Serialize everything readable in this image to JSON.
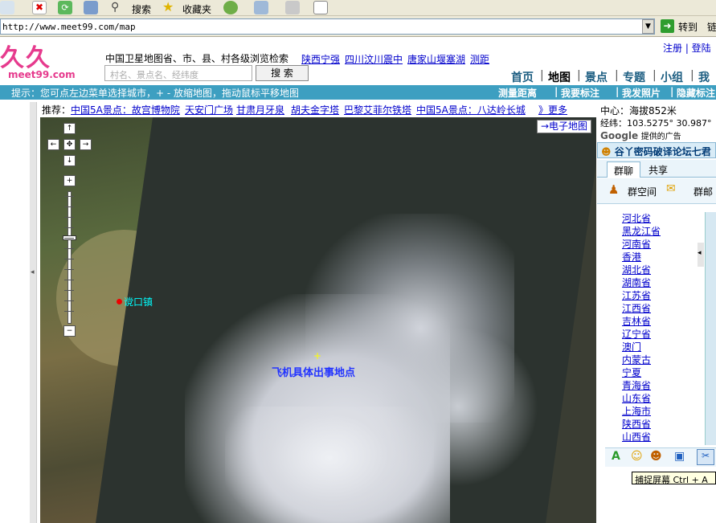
{
  "browser": {
    "toolbar": {
      "search_label": "搜索",
      "favorites_label": "收藏夹"
    },
    "address": {
      "url": "http://www.meet99.com/map",
      "go_label": "转到",
      "links_label": "链"
    }
  },
  "site": {
    "logo_text": "久久",
    "logo_sub": "meet99.com",
    "tagline": "中国卫星地图省、市、县、村各级浏览检索",
    "header_links": [
      "陕西宁强",
      "四川汶川震中",
      "唐家山堰塞湖",
      "测距"
    ],
    "search_placeholder": "村名、景点名、经纬度",
    "search_button": "搜 索",
    "auth": "注册 | 登陆",
    "nav": [
      "首页",
      "地图",
      "景点",
      "专题",
      "小组",
      "我"
    ]
  },
  "hintbar": {
    "hint": "提示：您可点左边菜单选择城市，+ - 放缩地图，拖动鼠标平移地图",
    "tools": [
      "测量距离",
      "我要标注",
      "我发照片",
      "隐藏标注"
    ]
  },
  "recommend": {
    "label": "推荐：",
    "links": [
      "中国5A景点：故宫博物院",
      "天安门广场",
      "甘肃月牙泉",
      "胡夫金字塔",
      "巴黎艾菲尔铁塔",
      "中国5A景点：八达岭长城"
    ],
    "more": "》更多"
  },
  "map": {
    "elec_map_button": "→电子地图",
    "town_label": "谠口镇",
    "crosshair": "+",
    "incident_label": "飞机具体出事地点",
    "nav_symbols": {
      "up": "↑",
      "left": "←",
      "center": "✥",
      "right": "→",
      "down": "↓",
      "zoom_in": "+",
      "zoom_out": "−"
    },
    "zoom_level_fraction": 0.35
  },
  "right_panel": {
    "center_label": "中心：海拔852米",
    "coords": "经纬：103.5275°  30.987°",
    "google_ad": "Google",
    "google_ad_suffix": "提供的广告",
    "qq_title": "谷丫密码破译论坛七君",
    "tabs": [
      "群聊",
      "共享"
    ],
    "tools": [
      "群空间",
      "群邮"
    ],
    "provinces": [
      "河北省",
      "黑龙江省",
      "河南省",
      "香港",
      "湖北省",
      "湖南省",
      "江苏省",
      "江西省",
      "吉林省",
      "辽宁省",
      "澳门",
      "内蒙古",
      "宁夏",
      "青海省",
      "山东省",
      "上海市",
      "陕西省",
      "山西省"
    ],
    "tooltip": "捕捉屏幕 Ctrl + A"
  },
  "colors": {
    "brand_pink": "#e63a8d",
    "hint_bar": "#3d9fc1",
    "link_blue": "#0000cc"
  }
}
